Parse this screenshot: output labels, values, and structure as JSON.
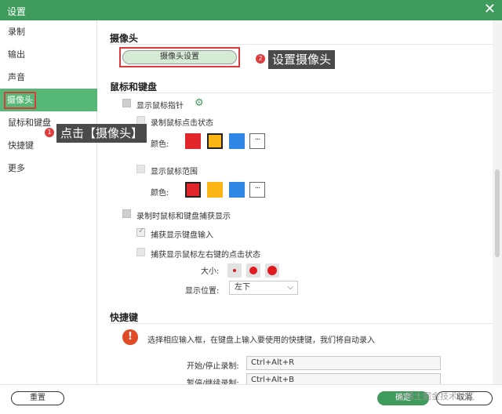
{
  "window": {
    "title": "设置",
    "close_icon": "close-icon"
  },
  "sidebar": {
    "items": [
      {
        "label": "录制"
      },
      {
        "label": "输出"
      },
      {
        "label": "声音"
      },
      {
        "label": "摄像头"
      },
      {
        "label": "鼠标和键盘"
      },
      {
        "label": "快捷键"
      },
      {
        "label": "更多"
      }
    ]
  },
  "camera": {
    "title": "摄像头",
    "settings_button": "摄像头设置"
  },
  "annotations": {
    "step1_number": "1",
    "step1_text": "点击【摄像头】",
    "step2_number": "2",
    "step2_text": "设置摄像头",
    "highlight_color": "#d83b3b"
  },
  "mouse_keyboard": {
    "title": "鼠标和键盘",
    "show_cursor": "显示鼠标指针",
    "record_click_state": "录制鼠标点击状态",
    "color_label_1": "颜色:",
    "show_cursor_range": "显示鼠标范围",
    "color_label_2": "颜色:",
    "capture_display": "录制时鼠标和键盘捕获显示",
    "capture_keyboard_input": "捕获显示键盘输入",
    "capture_mouse_clicks": "捕获显示鼠标左右键的点击状态",
    "size_label": "大小:",
    "position_label": "显示位置:",
    "position_value": "左下",
    "swatch_colors": [
      "#e0262a",
      "#fbb515",
      "#2f86e5"
    ],
    "more_label": "···"
  },
  "shortcuts": {
    "title": "快捷键",
    "notice": "选择相应输入框，在键盘上输入要使用的快捷键，我们将自动录入",
    "rows": [
      {
        "label": "开始/停止录制:",
        "value": "Ctrl+Alt+R"
      },
      {
        "label": "暂停/继续录制:",
        "value": "Ctrl+Alt+B"
      }
    ]
  },
  "footer": {
    "reset": "重置",
    "ok": "确定",
    "cancel": "取消",
    "watermark": "@稀土掘金技术社区"
  },
  "colors": {
    "accent": "#3e9b5c",
    "active_nav": "#57b776"
  }
}
